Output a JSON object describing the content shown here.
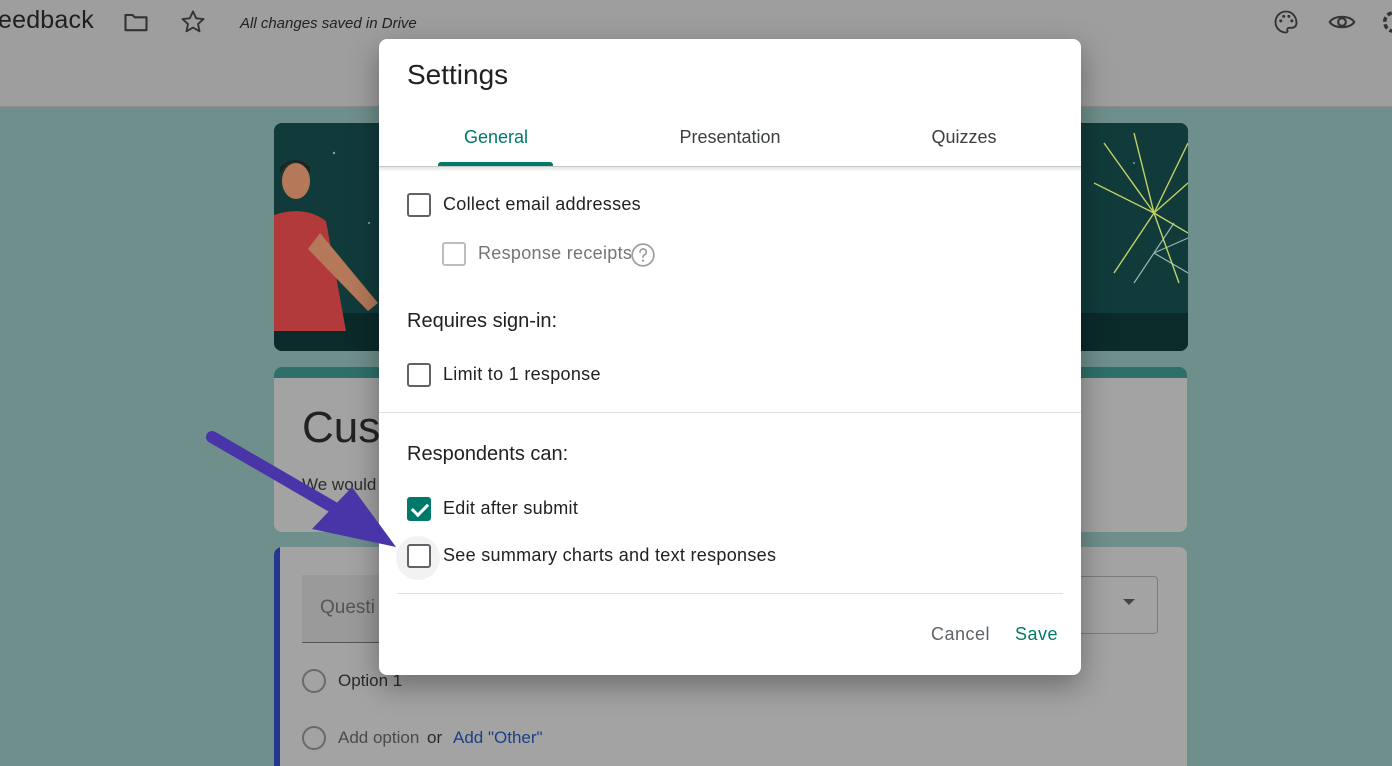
{
  "topbar": {
    "doc_title": "eedback",
    "saved_status": "All changes saved in Drive",
    "icons": [
      "folder-icon",
      "star-icon",
      "palette-icon",
      "eye-icon",
      "settings-gear-icon"
    ]
  },
  "form": {
    "title": "Cust",
    "description": "We would",
    "question": {
      "placeholder": "Questi",
      "option_1": "Option 1",
      "add_option": "Add option",
      "or": "or",
      "add_other": "Add \"Other\""
    }
  },
  "dialog": {
    "title": "Settings",
    "tabs": [
      {
        "label": "General",
        "active": true
      },
      {
        "label": "Presentation",
        "active": false
      },
      {
        "label": "Quizzes",
        "active": false
      }
    ],
    "options": {
      "collect_email": {
        "label": "Collect email addresses",
        "checked": false
      },
      "response_receipts": {
        "label": "Response receipts",
        "checked": false,
        "disabled": true
      },
      "requires_signin_heading": "Requires sign-in:",
      "limit_one": {
        "label": "Limit to 1 response",
        "checked": false
      },
      "respondents_heading": "Respondents can:",
      "edit_after_submit": {
        "label": "Edit after submit",
        "checked": true
      },
      "see_summary": {
        "label": "See summary charts and text responses",
        "checked": false
      }
    },
    "buttons": {
      "cancel": "Cancel",
      "save": "Save"
    }
  },
  "colors": {
    "accent": "#00796b",
    "annotation_arrow": "#4a35a8"
  }
}
